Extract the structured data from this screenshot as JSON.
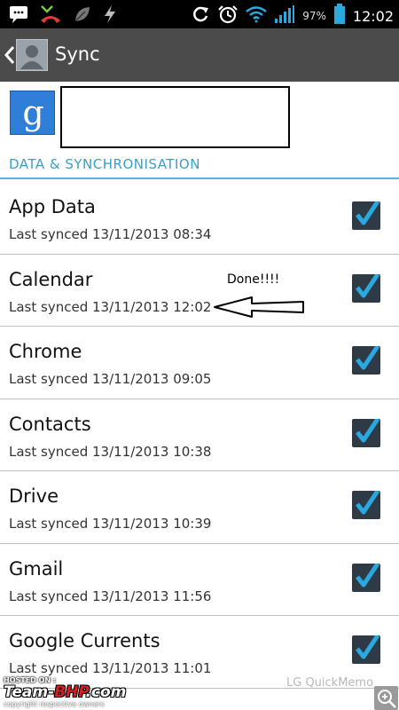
{
  "status_bar": {
    "battery_percent": "97%",
    "time": "12:02",
    "icons": [
      "message-icon",
      "missed-call-icon",
      "leaf-icon",
      "flash-icon",
      "sync-icon",
      "alarm-icon",
      "wifi-icon",
      "signal-icon",
      "battery-icon"
    ]
  },
  "action_bar": {
    "title": "Sync"
  },
  "section": {
    "header": "DATA & SYNCHRONISATION"
  },
  "sync_items": [
    {
      "name": "App Data",
      "status": "Last synced 13/11/2013 08:34",
      "checked": true
    },
    {
      "name": "Calendar",
      "status": "Last synced 13/11/2013 12:02",
      "checked": true
    },
    {
      "name": "Chrome",
      "status": "Last synced 13/11/2013 09:05",
      "checked": true
    },
    {
      "name": "Contacts",
      "status": "Last synced 13/11/2013 10:38",
      "checked": true
    },
    {
      "name": "Drive",
      "status": "Last synced 13/11/2013 10:39",
      "checked": true
    },
    {
      "name": "Gmail",
      "status": "Last synced 13/11/2013 11:56",
      "checked": true
    },
    {
      "name": "Google Currents",
      "status": "Last synced 13/11/2013 11:01",
      "checked": true
    }
  ],
  "annotation": {
    "text": "Done!!!!"
  },
  "watermark": {
    "hosted_on": "HOSTED ON :",
    "team": "Team-",
    "bhp": "BHP",
    "dotcom": ".com",
    "copyright": "copyright respective owners",
    "quickmemo": "LG QuickMemo"
  },
  "colors": {
    "accent": "#3a9fc9",
    "checkbox_bg": "#2e3b46",
    "check_mark": "#29a9e0",
    "action_bar": "#4b4b4b"
  }
}
